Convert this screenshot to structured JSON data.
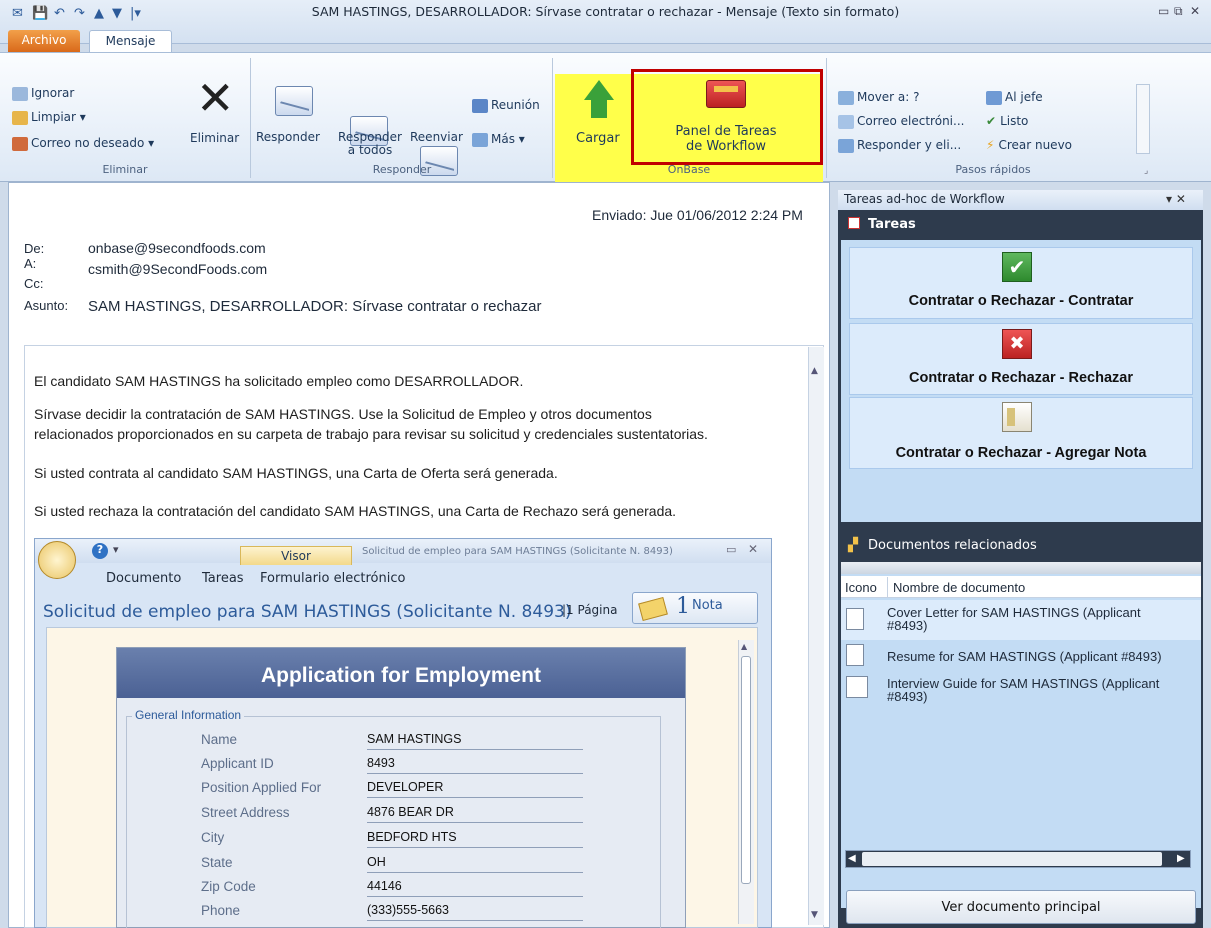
{
  "window": {
    "title": "SAM HASTINGS, DESARROLLADOR: Sírvase contratar o rechazar - Mensaje (Texto sin formato)",
    "controls": [
      "▭",
      "⧉",
      "✕"
    ]
  },
  "tabs": {
    "archivo": "Archivo",
    "mensaje": "Mensaje"
  },
  "ribbon": {
    "eliminar": {
      "ignorar": "Ignorar",
      "limpiar": "Limpiar ▾",
      "correo_no_deseado": "Correo no deseado ▾",
      "eliminar": "Eliminar",
      "label": "Eliminar"
    },
    "responder": {
      "responder": "Responder",
      "responder_todos_1": "Responder",
      "responder_todos_2": "a todos",
      "reenviar": "Reenviar",
      "reunion": "Reunión",
      "mas": "Más ▾",
      "label": "Responder"
    },
    "onbase": {
      "cargar": "Cargar",
      "panel_1": "Panel de Tareas",
      "panel_2": "de Workflow",
      "label": "OnBase"
    },
    "pasos": {
      "mover": "Mover a: ?",
      "al_jefe": "Al jefe",
      "correo_electronico": "Correo electróni...",
      "listo": "Listo",
      "responder_eliminar": "Responder y eli...",
      "crear_nuevo": "Crear nuevo",
      "label": "Pasos rápidos"
    }
  },
  "email": {
    "sent": "Enviado: Jue 01/06/2012 2:24 PM",
    "de_label": "De:",
    "de": "onbase@9secondfoods.com",
    "a_label": "A:",
    "a": "csmith@9SecondFoods.com",
    "cc_label": "Cc:",
    "asunto_label": "Asunto:",
    "asunto": "SAM HASTINGS, DESARROLLADOR: Sírvase contratar o rechazar",
    "body": [
      "El candidato SAM HASTINGS ha solicitado empleo como DESARROLLADOR.",
      "Sírvase decidir la contratación de SAM HASTINGS. Use la Solicitud de Empleo y otros documentos",
      "relacionados proporcionados en su carpeta de trabajo para revisar su solicitud y credenciales sustentatorias.",
      "Si usted contrata al candidato SAM HASTINGS, una Carta de Oferta será generada.",
      "Si usted rechaza la contratación del candidato SAM HASTINGS, una Carta de Rechazo será generada."
    ]
  },
  "viewer": {
    "tab": "Visor",
    "title_small": "Solicitud de empleo para SAM HASTINGS (Solicitante N. 8493)",
    "menu": [
      "Documento",
      "Tareas",
      "Formulario electrónico"
    ],
    "heading": "Solicitud de empleo para SAM HASTINGS (Solicitante N. 8493)",
    "pages": "|1 Página",
    "notes_count": "1",
    "notes_label": "Nota",
    "form": {
      "title": "Application for Employment",
      "section": "General Information",
      "rows": [
        {
          "label": "Name",
          "value": "SAM HASTINGS"
        },
        {
          "label": "Applicant ID",
          "value": "8493"
        },
        {
          "label": "Position Applied For",
          "value": "DEVELOPER"
        },
        {
          "label": "Street Address",
          "value": "4876 BEAR DR"
        },
        {
          "label": "City",
          "value": "BEDFORD HTS"
        },
        {
          "label": "State",
          "value": "OH"
        },
        {
          "label": "Zip Code",
          "value": "44146"
        },
        {
          "label": "Phone",
          "value": "(333)555-5663"
        }
      ]
    }
  },
  "panel": {
    "title": "Tareas ad-hoc de Workflow",
    "close": "▾ ✕",
    "tasks_header": "Tareas",
    "tasks": [
      "Contratar o Rechazar - Contratar",
      "Contratar o Rechazar - Rechazar",
      "Contratar o Rechazar - Agregar Nota"
    ],
    "docs_header": "Documentos relacionados",
    "col_icono": "Icono",
    "col_nombre": "Nombre de documento",
    "docs": [
      {
        "l1": "Cover Letter for SAM HASTINGS (Applicant",
        "l2": "#8493)"
      },
      {
        "l1": "Resume for SAM HASTINGS (Applicant #8493)",
        "l2": ""
      },
      {
        "l1": "Interview Guide for SAM HASTINGS (Applicant",
        "l2": "#8493)"
      }
    ],
    "ver_documento": "Ver documento principal"
  },
  "colors": {
    "highlight": "#ffff4a",
    "outline": "#c00000",
    "archivo": "#e07a24",
    "panel_dark": "#2e3b4d",
    "panel_light": "#c3dcf4"
  }
}
